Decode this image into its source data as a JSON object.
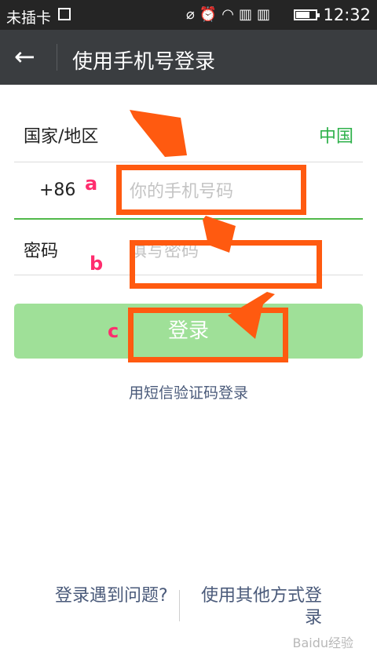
{
  "status_bar": {
    "carrier": "未插卡",
    "icons": [
      "mute-icon",
      "alarm-icon",
      "wifi-icon",
      "data-icon",
      "data-icon"
    ],
    "battery_level": 0.7,
    "time": "12:32"
  },
  "app_bar": {
    "title": "使用手机号登录"
  },
  "form": {
    "region_label": "国家/地区",
    "region_value": "中国",
    "country_code": "+86",
    "phone_placeholder": "你的手机号码",
    "password_label": "密码",
    "password_placeholder": "填写密码"
  },
  "login_button": "登录",
  "sms_login_link": "用短信验证码登录",
  "bottom": {
    "trouble_link": "登录遇到问题?",
    "other_methods_link": "使用其他方式登录"
  },
  "annotations": {
    "a": "a",
    "b": "b",
    "c": "c",
    "color": "#ff5a10"
  },
  "watermark": "Baidu经验",
  "colors": {
    "accent_green": "#2fb14b",
    "button_green": "#9fe098",
    "app_bar": "#3a3d40"
  }
}
